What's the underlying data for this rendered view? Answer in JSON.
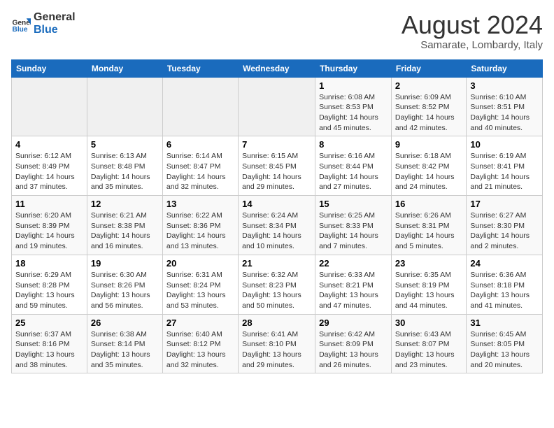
{
  "logo": {
    "line1": "General",
    "line2": "Blue"
  },
  "title": "August 2024",
  "subtitle": "Samarate, Lombardy, Italy",
  "headers": [
    "Sunday",
    "Monday",
    "Tuesday",
    "Wednesday",
    "Thursday",
    "Friday",
    "Saturday"
  ],
  "weeks": [
    [
      {
        "day": "",
        "info": ""
      },
      {
        "day": "",
        "info": ""
      },
      {
        "day": "",
        "info": ""
      },
      {
        "day": "",
        "info": ""
      },
      {
        "day": "1",
        "info": "Sunrise: 6:08 AM\nSunset: 8:53 PM\nDaylight: 14 hours and 45 minutes."
      },
      {
        "day": "2",
        "info": "Sunrise: 6:09 AM\nSunset: 8:52 PM\nDaylight: 14 hours and 42 minutes."
      },
      {
        "day": "3",
        "info": "Sunrise: 6:10 AM\nSunset: 8:51 PM\nDaylight: 14 hours and 40 minutes."
      }
    ],
    [
      {
        "day": "4",
        "info": "Sunrise: 6:12 AM\nSunset: 8:49 PM\nDaylight: 14 hours and 37 minutes."
      },
      {
        "day": "5",
        "info": "Sunrise: 6:13 AM\nSunset: 8:48 PM\nDaylight: 14 hours and 35 minutes."
      },
      {
        "day": "6",
        "info": "Sunrise: 6:14 AM\nSunset: 8:47 PM\nDaylight: 14 hours and 32 minutes."
      },
      {
        "day": "7",
        "info": "Sunrise: 6:15 AM\nSunset: 8:45 PM\nDaylight: 14 hours and 29 minutes."
      },
      {
        "day": "8",
        "info": "Sunrise: 6:16 AM\nSunset: 8:44 PM\nDaylight: 14 hours and 27 minutes."
      },
      {
        "day": "9",
        "info": "Sunrise: 6:18 AM\nSunset: 8:42 PM\nDaylight: 14 hours and 24 minutes."
      },
      {
        "day": "10",
        "info": "Sunrise: 6:19 AM\nSunset: 8:41 PM\nDaylight: 14 hours and 21 minutes."
      }
    ],
    [
      {
        "day": "11",
        "info": "Sunrise: 6:20 AM\nSunset: 8:39 PM\nDaylight: 14 hours and 19 minutes."
      },
      {
        "day": "12",
        "info": "Sunrise: 6:21 AM\nSunset: 8:38 PM\nDaylight: 14 hours and 16 minutes."
      },
      {
        "day": "13",
        "info": "Sunrise: 6:22 AM\nSunset: 8:36 PM\nDaylight: 14 hours and 13 minutes."
      },
      {
        "day": "14",
        "info": "Sunrise: 6:24 AM\nSunset: 8:34 PM\nDaylight: 14 hours and 10 minutes."
      },
      {
        "day": "15",
        "info": "Sunrise: 6:25 AM\nSunset: 8:33 PM\nDaylight: 14 hours and 7 minutes."
      },
      {
        "day": "16",
        "info": "Sunrise: 6:26 AM\nSunset: 8:31 PM\nDaylight: 14 hours and 5 minutes."
      },
      {
        "day": "17",
        "info": "Sunrise: 6:27 AM\nSunset: 8:30 PM\nDaylight: 14 hours and 2 minutes."
      }
    ],
    [
      {
        "day": "18",
        "info": "Sunrise: 6:29 AM\nSunset: 8:28 PM\nDaylight: 13 hours and 59 minutes."
      },
      {
        "day": "19",
        "info": "Sunrise: 6:30 AM\nSunset: 8:26 PM\nDaylight: 13 hours and 56 minutes."
      },
      {
        "day": "20",
        "info": "Sunrise: 6:31 AM\nSunset: 8:24 PM\nDaylight: 13 hours and 53 minutes."
      },
      {
        "day": "21",
        "info": "Sunrise: 6:32 AM\nSunset: 8:23 PM\nDaylight: 13 hours and 50 minutes."
      },
      {
        "day": "22",
        "info": "Sunrise: 6:33 AM\nSunset: 8:21 PM\nDaylight: 13 hours and 47 minutes."
      },
      {
        "day": "23",
        "info": "Sunrise: 6:35 AM\nSunset: 8:19 PM\nDaylight: 13 hours and 44 minutes."
      },
      {
        "day": "24",
        "info": "Sunrise: 6:36 AM\nSunset: 8:18 PM\nDaylight: 13 hours and 41 minutes."
      }
    ],
    [
      {
        "day": "25",
        "info": "Sunrise: 6:37 AM\nSunset: 8:16 PM\nDaylight: 13 hours and 38 minutes."
      },
      {
        "day": "26",
        "info": "Sunrise: 6:38 AM\nSunset: 8:14 PM\nDaylight: 13 hours and 35 minutes."
      },
      {
        "day": "27",
        "info": "Sunrise: 6:40 AM\nSunset: 8:12 PM\nDaylight: 13 hours and 32 minutes."
      },
      {
        "day": "28",
        "info": "Sunrise: 6:41 AM\nSunset: 8:10 PM\nDaylight: 13 hours and 29 minutes."
      },
      {
        "day": "29",
        "info": "Sunrise: 6:42 AM\nSunset: 8:09 PM\nDaylight: 13 hours and 26 minutes."
      },
      {
        "day": "30",
        "info": "Sunrise: 6:43 AM\nSunset: 8:07 PM\nDaylight: 13 hours and 23 minutes."
      },
      {
        "day": "31",
        "info": "Sunrise: 6:45 AM\nSunset: 8:05 PM\nDaylight: 13 hours and 20 minutes."
      }
    ]
  ]
}
